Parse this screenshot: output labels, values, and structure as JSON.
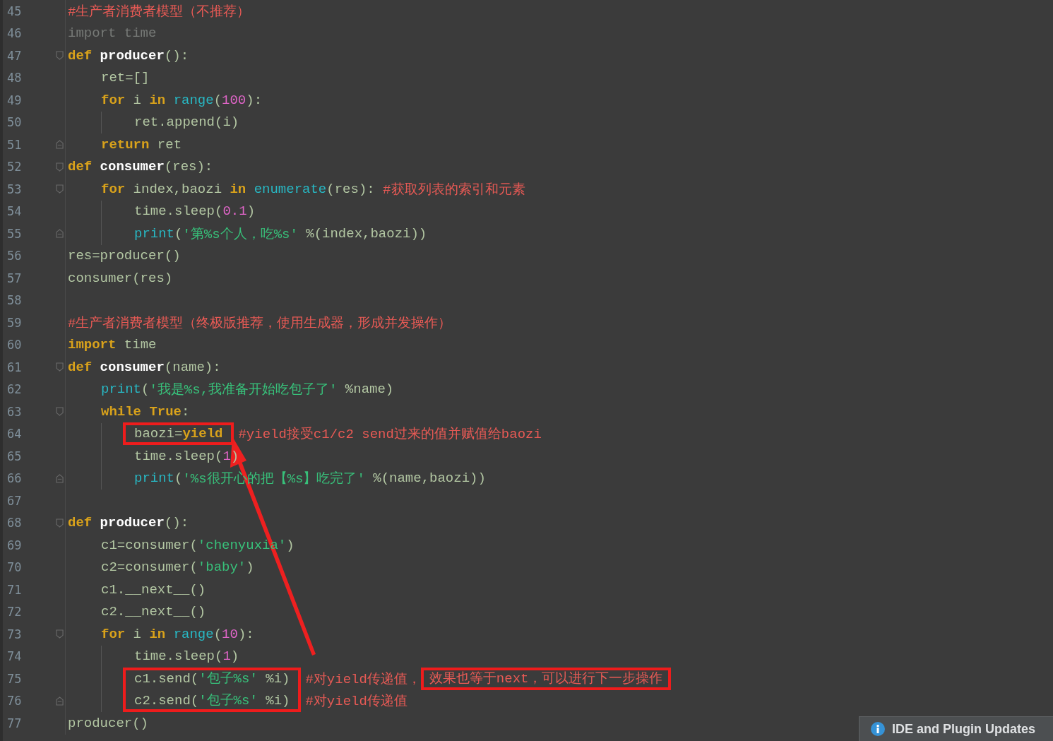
{
  "editor": {
    "lines": [
      {
        "number": "45",
        "fold_start": false,
        "fold_end": false,
        "tokens": [
          {
            "kind": "comment",
            "text": "#生产者消费者模型（不推荐）"
          }
        ]
      },
      {
        "number": "46",
        "fold_start": false,
        "fold_end": false,
        "tokens": [
          {
            "kind": "dim",
            "text": "import time"
          }
        ]
      },
      {
        "number": "47",
        "fold_start": true,
        "fold_end": false,
        "tokens": [
          {
            "kind": "kw",
            "text": "def "
          },
          {
            "kind": "defname",
            "text": "producer"
          },
          {
            "kind": "plain",
            "text": "():"
          }
        ],
        "children": [
          {
            "number": "48",
            "fold_start": false,
            "fold_end": false,
            "tokens": [
              {
                "kind": "plain",
                "text": "ret=[]"
              }
            ]
          },
          {
            "number": "49",
            "fold_start": false,
            "fold_end": false,
            "tokens": [
              {
                "kind": "kw",
                "text": "for "
              },
              {
                "kind": "plain",
                "text": "i "
              },
              {
                "kind": "kw",
                "text": "in "
              },
              {
                "kind": "builtin",
                "text": "range"
              },
              {
                "kind": "plain",
                "text": "("
              },
              {
                "kind": "num",
                "text": "100"
              },
              {
                "kind": "plain",
                "text": "):"
              }
            ],
            "children": [
              {
                "number": "50",
                "fold_start": false,
                "fold_end": false,
                "tokens": [
                  {
                    "kind": "plain",
                    "text": "ret.append(i)"
                  }
                ]
              }
            ]
          },
          {
            "number": "51",
            "fold_start": false,
            "fold_end": true,
            "tokens": [
              {
                "kind": "kw",
                "text": "return "
              },
              {
                "kind": "plain",
                "text": "ret"
              }
            ]
          }
        ]
      },
      {
        "number": "52",
        "fold_start": true,
        "fold_end": false,
        "tokens": [
          {
            "kind": "kw",
            "text": "def "
          },
          {
            "kind": "defname",
            "text": "consumer"
          },
          {
            "kind": "plain",
            "text": "(res):"
          }
        ],
        "children": [
          {
            "number": "53",
            "fold_start": true,
            "fold_end": false,
            "tokens": [
              {
                "kind": "kw",
                "text": "for "
              },
              {
                "kind": "plain",
                "text": "index,baozi "
              },
              {
                "kind": "kw",
                "text": "in "
              },
              {
                "kind": "builtin",
                "text": "enumerate"
              },
              {
                "kind": "plain",
                "text": "(res): "
              },
              {
                "kind": "comment",
                "text": "#获取列表的索引和元素"
              }
            ],
            "children": [
              {
                "number": "54",
                "fold_start": false,
                "fold_end": false,
                "tokens": [
                  {
                    "kind": "plain",
                    "text": "time.sleep("
                  },
                  {
                    "kind": "num",
                    "text": "0.1"
                  },
                  {
                    "kind": "plain",
                    "text": ")"
                  }
                ]
              },
              {
                "number": "55",
                "fold_start": false,
                "fold_end": true,
                "tokens": [
                  {
                    "kind": "builtin",
                    "text": "print"
                  },
                  {
                    "kind": "plain",
                    "text": "("
                  },
                  {
                    "kind": "str",
                    "text": "'第%s个人，吃%s'"
                  },
                  {
                    "kind": "plain",
                    "text": " %(index,baozi))"
                  }
                ]
              }
            ]
          }
        ]
      },
      {
        "number": "56",
        "fold_start": false,
        "fold_end": false,
        "tokens": [
          {
            "kind": "plain",
            "text": "res=producer()"
          }
        ]
      },
      {
        "number": "57",
        "fold_start": false,
        "fold_end": false,
        "tokens": [
          {
            "kind": "plain",
            "text": "consumer(res)"
          }
        ]
      },
      {
        "number": "58",
        "fold_start": false,
        "fold_end": false
      },
      {
        "number": "59",
        "fold_start": false,
        "fold_end": false,
        "tokens": [
          {
            "kind": "comment",
            "text": "#生产者消费者模型（终极版推荐，使用生成器，形成并发操作）"
          }
        ]
      },
      {
        "number": "60",
        "fold_start": false,
        "fold_end": false,
        "tokens": [
          {
            "kind": "kw",
            "text": "import "
          },
          {
            "kind": "plain",
            "text": "time"
          }
        ]
      },
      {
        "number": "61",
        "fold_start": true,
        "fold_end": false,
        "tokens": [
          {
            "kind": "kw",
            "text": "def "
          },
          {
            "kind": "defname",
            "text": "consumer"
          },
          {
            "kind": "plain",
            "text": "(name):"
          }
        ],
        "children": [
          {
            "number": "62",
            "fold_start": false,
            "fold_end": false,
            "tokens": [
              {
                "kind": "builtin",
                "text": "print"
              },
              {
                "kind": "plain",
                "text": "("
              },
              {
                "kind": "str",
                "text": "'我是%s,我准备开始吃包子了'"
              },
              {
                "kind": "plain",
                "text": " %name)"
              }
            ]
          },
          {
            "number": "63",
            "fold_start": true,
            "fold_end": false,
            "tokens": [
              {
                "kind": "kw",
                "text": "while True"
              },
              {
                "kind": "plain",
                "text": ":"
              }
            ],
            "children": [
              {
                "number": "64",
                "fold_start": false,
                "fold_end": false,
                "tokens": [
                  {
                    "boxed": true,
                    "tokens": [
                      {
                        "kind": "plain",
                        "text": "baozi="
                      },
                      {
                        "kind": "kw",
                        "text": "yield"
                      }
                    ]
                  },
                  {
                    "kind": "comment",
                    "text": "#yield接受c1/c2 send过来的值并赋值给baozi"
                  }
                ]
              },
              {
                "number": "65",
                "fold_start": false,
                "fold_end": false,
                "tokens": [
                  {
                    "kind": "plain",
                    "text": "time.sleep("
                  },
                  {
                    "kind": "num",
                    "text": "1"
                  },
                  {
                    "kind": "plain",
                    "text": ")"
                  }
                ]
              },
              {
                "number": "66",
                "fold_start": false,
                "fold_end": true,
                "tokens": [
                  {
                    "kind": "builtin",
                    "text": "print"
                  },
                  {
                    "kind": "plain",
                    "text": "("
                  },
                  {
                    "kind": "str",
                    "text": "'%s很开心的把【%s】吃完了'"
                  },
                  {
                    "kind": "plain",
                    "text": " %(name,baozi))"
                  }
                ]
              }
            ]
          }
        ]
      },
      {
        "number": "67",
        "fold_start": false,
        "fold_end": false
      },
      {
        "number": "68",
        "fold_start": true,
        "fold_end": false,
        "tokens": [
          {
            "kind": "kw",
            "text": "def "
          },
          {
            "kind": "defname",
            "text": "producer"
          },
          {
            "kind": "plain",
            "text": "():"
          }
        ],
        "children": [
          {
            "number": "69",
            "fold_start": false,
            "fold_end": false,
            "tokens": [
              {
                "kind": "plain",
                "text": "c1=consumer("
              },
              {
                "kind": "str",
                "text": "'chenyuxia'"
              },
              {
                "kind": "plain",
                "text": ")"
              }
            ]
          },
          {
            "number": "70",
            "fold_start": false,
            "fold_end": false,
            "tokens": [
              {
                "kind": "plain",
                "text": "c2=consumer("
              },
              {
                "kind": "str",
                "text": "'baby'"
              },
              {
                "kind": "plain",
                "text": ")"
              }
            ]
          },
          {
            "number": "71",
            "fold_start": false,
            "fold_end": false,
            "tokens": [
              {
                "kind": "plain",
                "text": "c1.__next__()"
              }
            ]
          },
          {
            "number": "72",
            "fold_start": false,
            "fold_end": false,
            "tokens": [
              {
                "kind": "plain",
                "text": "c2.__next__()"
              }
            ]
          },
          {
            "number": "73",
            "fold_start": true,
            "fold_end": false,
            "tokens": [
              {
                "kind": "kw",
                "text": "for "
              },
              {
                "kind": "plain",
                "text": "i "
              },
              {
                "kind": "kw",
                "text": "in "
              },
              {
                "kind": "builtin",
                "text": "range"
              },
              {
                "kind": "plain",
                "text": "("
              },
              {
                "kind": "num",
                "text": "10"
              },
              {
                "kind": "plain",
                "text": "):"
              }
            ],
            "children": [
              {
                "number": "74",
                "fold_start": false,
                "fold_end": false,
                "tokens": [
                  {
                    "kind": "plain",
                    "text": "time.sleep("
                  },
                  {
                    "kind": "num",
                    "text": "1"
                  },
                  {
                    "kind": "plain",
                    "text": ")"
                  }
                ]
              },
              {
                "number": "75",
                "fold_start": false,
                "fold_end": false,
                "tokens": [
                  {
                    "boxed": true,
                    "box_joins_next": true,
                    "tokens": [
                      {
                        "kind": "plain",
                        "text": "c1.send("
                      },
                      {
                        "kind": "str",
                        "text": "'包子%s'"
                      },
                      {
                        "kind": "plain",
                        "text": " %i)"
                      }
                    ]
                  },
                  {
                    "kind": "comment",
                    "text": "#对yield传递值，"
                  },
                  {
                    "boxed": true,
                    "tokens": [
                      {
                        "kind": "comment",
                        "text": "效果也等于next，可以进行下一步操作"
                      }
                    ]
                  }
                ]
              },
              {
                "number": "76",
                "fold_start": false,
                "fold_end": true,
                "tokens": [
                  {
                    "boxed": true,
                    "box_joins_previous": true,
                    "tokens": [
                      {
                        "kind": "plain",
                        "text": "c2.send("
                      },
                      {
                        "kind": "str",
                        "text": "'包子%s'"
                      },
                      {
                        "kind": "plain",
                        "text": " %i)"
                      }
                    ]
                  },
                  {
                    "kind": "comment",
                    "text": "#对yield传递值"
                  }
                ]
              }
            ]
          }
        ]
      },
      {
        "number": "77",
        "fold_start": false,
        "fold_end": false,
        "tokens": [
          {
            "kind": "plain",
            "text": "producer()"
          }
        ]
      }
    ]
  },
  "notification": {
    "title": "IDE and Plugin Updates"
  }
}
